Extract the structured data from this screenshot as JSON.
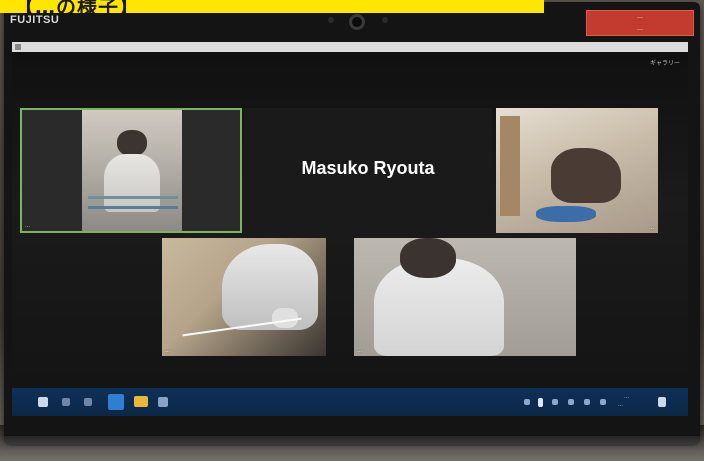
{
  "photo": {
    "caption_banner": "【…の様子】",
    "laptop_brand": "FUJITSU",
    "status_label_line1": "…",
    "status_label_line2": "…"
  },
  "meeting": {
    "view_label": "ギャラリー",
    "active_speaker": "Masuko Ryouta",
    "tiles": [
      {
        "name": "…",
        "highlighted": true
      },
      {
        "name": "…",
        "highlighted": false
      },
      {
        "name": "…",
        "highlighted": false
      },
      {
        "name": "…",
        "highlighted": false
      }
    ]
  },
  "taskbar": {
    "clock_time": "…",
    "clock_date": "…",
    "icons": [
      "start-icon",
      "search-icon",
      "task-view-icon",
      "edge-icon",
      "explorer-icon",
      "app-icon"
    ]
  },
  "colors": {
    "banner": "#ffe600",
    "status_label": "#c23b2e",
    "active_tile_border": "#7fb55a",
    "taskbar": "#0e2f58"
  }
}
